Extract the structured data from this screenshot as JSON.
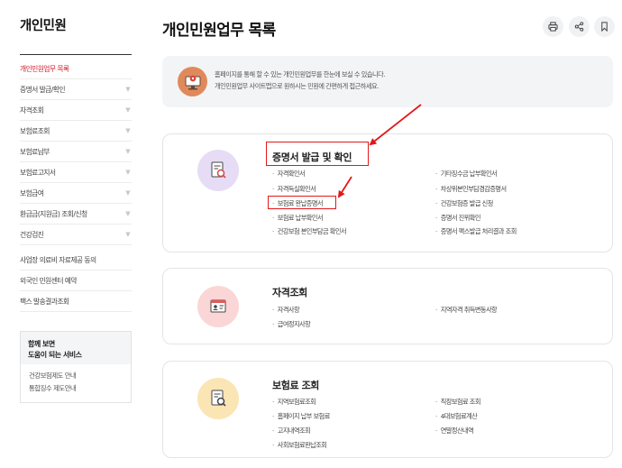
{
  "sidebar": {
    "title": "개인민원",
    "items": [
      {
        "label": "개인민원업무 목록",
        "active": true,
        "chevron": false
      },
      {
        "label": "증명서 발급/확인",
        "active": false,
        "chevron": true
      },
      {
        "label": "자격조회",
        "active": false,
        "chevron": true
      },
      {
        "label": "보험료조회",
        "active": false,
        "chevron": true
      },
      {
        "label": "보험료납부",
        "active": false,
        "chevron": true
      },
      {
        "label": "보험료고지서",
        "active": false,
        "chevron": true
      },
      {
        "label": "보험급여",
        "active": false,
        "chevron": true
      },
      {
        "label": "환급금(지원금) 조회/신청",
        "active": false,
        "chevron": true
      },
      {
        "label": "건강검진",
        "active": false,
        "chevron": true
      },
      {
        "label": "사업장 의료비 자료제공 동의",
        "active": false,
        "chevron": false
      },
      {
        "label": "외국인 민원센터 예약",
        "active": false,
        "chevron": false
      },
      {
        "label": "팩스 발송결과조회",
        "active": false,
        "chevron": false
      }
    ],
    "chevron_glyph": "▼",
    "related": {
      "heading_line1": "함께 보면",
      "heading_line2": "도움이 되는 서비스",
      "links": [
        "건강보험제도 안내",
        "통합징수 제도안내"
      ]
    }
  },
  "header": {
    "title": "개인민원업무 목록",
    "tools": [
      "print-icon",
      "share-icon",
      "bookmark-icon"
    ]
  },
  "notice": {
    "line1": "홈페이지를 통해 할 수 있는 개인민원업무를 한눈에 보실 수 있습니다.",
    "line2": "개인민원업무 사이트맵으로 원하시는 민원에 간편하게 접근하세요.",
    "icon": "monitor-pin-icon"
  },
  "sections": [
    {
      "title": "증명서 발급 및 확인",
      "icon": "certificate-search-icon",
      "left": [
        "자격확인서",
        "자격득실확인서",
        "보험료 완납증명서",
        "보험료 납부확인서",
        "건강보험 본인부담금 확인서"
      ],
      "right": [
        "기타징수금 납부확인서",
        "차상위본인부담경감증명서",
        "건강보험증 발급 신청",
        "증명서 진위확인",
        "증명서 팩스발급 처리결과 조회"
      ]
    },
    {
      "title": "자격조회",
      "icon": "id-card-icon",
      "left": [
        "자격사항",
        "급여정지사항"
      ],
      "right": [
        "지역자격 취득변동사항"
      ]
    },
    {
      "title": "보험료 조회",
      "icon": "document-search-icon",
      "left": [
        "지역보험료조회",
        "홈페이지 납부 보험료",
        "고지내역조회",
        "사회보험료완납조회"
      ],
      "right": [
        "직장보험료 조회",
        "4대보험료계산",
        "연말정산내역"
      ]
    }
  ],
  "bullet": "·",
  "colors": {
    "accent_red": "#d21a2a",
    "annotation_red": "#e31818",
    "icon_purple_bg": "#e6dcf6",
    "icon_pink_bg": "#fbd6d6",
    "icon_yellow_bg": "#fbe5b4",
    "notice_icon_bg": "#e08a5c"
  }
}
